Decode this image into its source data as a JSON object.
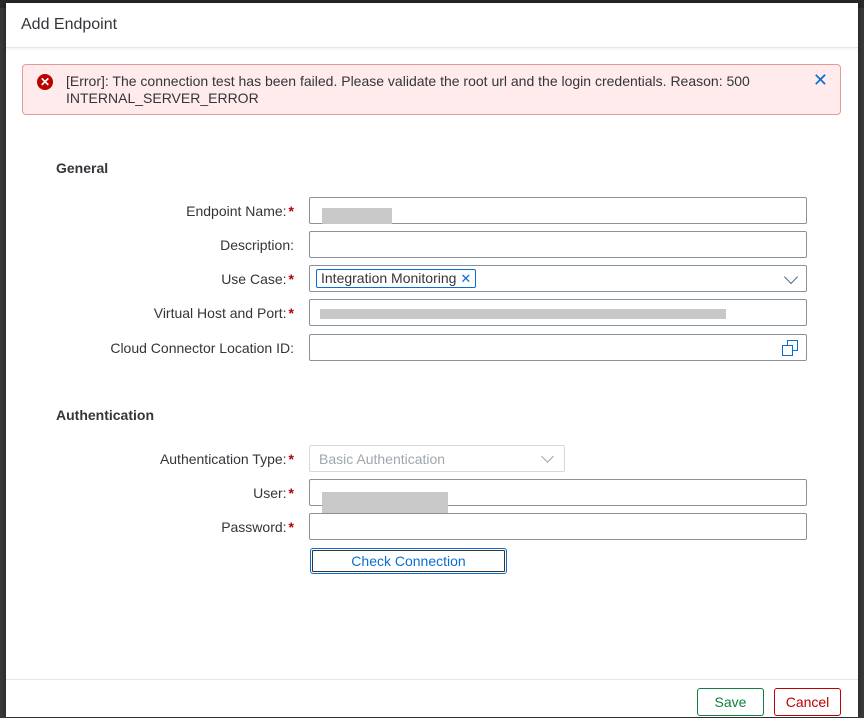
{
  "dialog": {
    "title": "Add Endpoint"
  },
  "error": {
    "text": "[Error]: The connection test has been failed. Please validate the root url and the login credentials. Reason: 500 INTERNAL_SERVER_ERROR",
    "icon": "error-circle-icon",
    "close_glyph": "✕"
  },
  "general": {
    "title": "General",
    "endpoint_name": {
      "label": "Endpoint Name:",
      "required": "*",
      "value": ""
    },
    "description": {
      "label": "Description:",
      "value": ""
    },
    "use_case": {
      "label": "Use Case:",
      "required": "*",
      "token": "Integration Monitoring",
      "token_remove": "✕"
    },
    "virtual_host": {
      "label": "Virtual Host and Port:",
      "required": "*",
      "value": ""
    },
    "cloud_connector": {
      "label": "Cloud Connector Location ID:",
      "value": ""
    }
  },
  "authentication": {
    "title": "Authentication",
    "type": {
      "label": "Authentication Type:",
      "required": "*",
      "value": "Basic Authentication"
    },
    "user": {
      "label": "User:",
      "required": "*",
      "value": ""
    },
    "password": {
      "label": "Password:",
      "required": "*",
      "value": ""
    },
    "check_connection_label": "Check Connection"
  },
  "footer": {
    "save_label": "Save",
    "cancel_label": "Cancel"
  },
  "colors": {
    "accent": "#0a6ed1",
    "error": "#bb0000",
    "positive": "#107e3e"
  }
}
